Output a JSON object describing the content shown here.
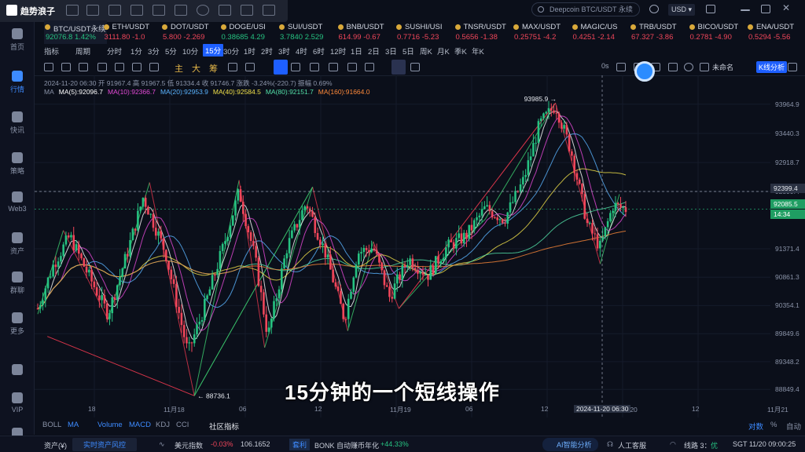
{
  "app": {
    "brand": "趋势浪子",
    "search_placeholder": "Deepcoin BTC/USDT 永续",
    "currency": "USD"
  },
  "sidebar": {
    "items": [
      {
        "label": "首页",
        "icon": "home-icon"
      },
      {
        "label": "行情",
        "icon": "chart-bars-icon"
      },
      {
        "label": "快讯",
        "icon": "news-icon"
      },
      {
        "label": "策略",
        "icon": "robot-icon"
      },
      {
        "label": "Web3",
        "icon": "web3-icon"
      },
      {
        "label": "资产",
        "icon": "wallet-icon"
      },
      {
        "label": "群聊",
        "icon": "chat-icon"
      },
      {
        "label": "更多",
        "icon": "grid-icon"
      },
      {
        "label": "",
        "icon": "phone-icon"
      },
      {
        "label": "VIP",
        "icon": "diamond-icon"
      },
      {
        "label": "",
        "icon": "settings-icon"
      }
    ]
  },
  "ticker": [
    {
      "name": "BTC/USDT永续",
      "price": "92076.8",
      "change": "1.42%",
      "up": true
    },
    {
      "name": "ETH/USDT",
      "price": "3111.80",
      "change": "-1.0",
      "up": false
    },
    {
      "name": "DOT/USDT",
      "price": "5.800",
      "change": "-2.269",
      "up": false
    },
    {
      "name": "DOGE/USI",
      "price": "0.38685",
      "change": "4.29",
      "up": true
    },
    {
      "name": "SUI/USDT",
      "price": "3.7840",
      "change": "2.529",
      "up": true
    },
    {
      "name": "BNB/USDT",
      "price": "614.99",
      "change": "-0.67",
      "up": false
    },
    {
      "name": "SUSHI/USI",
      "price": "0.7716",
      "change": "-5.23",
      "up": false
    },
    {
      "name": "TNSR/USDT",
      "price": "0.5656",
      "change": "-1.38",
      "up": false
    },
    {
      "name": "MAX/USDT",
      "price": "0.25751",
      "change": "-4.2",
      "up": false
    },
    {
      "name": "MAGIC/US",
      "price": "0.4251",
      "change": "-2.14",
      "up": false
    },
    {
      "name": "TRB/USDT",
      "price": "67.327",
      "change": "-3.86",
      "up": false
    },
    {
      "name": "BICO/USDT",
      "price": "0.2781",
      "change": "-4.90",
      "up": false
    },
    {
      "name": "ENA/USDT",
      "price": "0.5294",
      "change": "-5.56",
      "up": false
    }
  ],
  "periods": [
    "指标",
    "周期",
    "分时",
    "1分",
    "3分",
    "5分",
    "10分",
    "15分",
    "30分",
    "1时",
    "2时",
    "3时",
    "4时",
    "6时",
    "12时",
    "1日",
    "2日",
    "3日",
    "5日",
    "周K",
    "月K",
    "季K",
    "年K"
  ],
  "active_period": "15分",
  "toolrow": {
    "labels": [
      "主",
      "大",
      "筹"
    ],
    "countdown": "0s",
    "account": "未命名",
    "kline_btn": "K线分析"
  },
  "info_line": "2024-11-20 06:30  开 91967.4  高 91967.5  低 91334.4  收 91746.7  涨跌 -3.24%(-220.7)  振幅 0.69%",
  "ma_line": {
    "label": "MA",
    "items": [
      {
        "text": "MA(5):92096.7",
        "color": "#ffffff"
      },
      {
        "text": "MA(10):92366.7",
        "color": "#e64ad8"
      },
      {
        "text": "MA(20):92953.9",
        "color": "#5ab4ff"
      },
      {
        "text": "MA(40):92584.5",
        "color": "#f0e04a"
      },
      {
        "text": "MA(80):92151.7",
        "color": "#53e0a8"
      },
      {
        "text": "MA(160):91664.0",
        "color": "#ff8a3a"
      }
    ]
  },
  "chart_data": {
    "type": "candlestick",
    "y_ticks": [
      "93964.9",
      "93440.3",
      "92918.7",
      "92399.4",
      "91371.4",
      "90861.3",
      "90354.1",
      "89849.6",
      "89348.2",
      "88849.4"
    ],
    "x_ticks": [
      "18",
      "11月18",
      "06",
      "12",
      "11月19",
      "06",
      "12",
      "11月20",
      "12",
      "11月21"
    ],
    "cursor_time": "2024-11-20 06:30",
    "crosshair_price": "92399.4",
    "last_price": "92085.5",
    "countdown": "14:34",
    "high_label": "93985.9",
    "low_label": "88736.1",
    "ylim": [
      88600,
      94200
    ],
    "zigzag": [
      [
        0.0,
        90200
      ],
      [
        0.08,
        91700
      ],
      [
        0.22,
        90100
      ],
      [
        0.35,
        92560
      ],
      [
        0.49,
        88736
      ],
      [
        0.63,
        92600
      ],
      [
        0.71,
        89600
      ],
      [
        0.86,
        92480
      ],
      [
        0.97,
        89900
      ],
      [
        1.05,
        91500
      ],
      [
        1.13,
        90300
      ],
      [
        1.27,
        91200
      ],
      [
        1.4,
        91900
      ],
      [
        1.62,
        93985
      ],
      [
        1.76,
        91100
      ],
      [
        1.82,
        92350
      ]
    ],
    "closing_price_path": [
      [
        0.0,
        90300
      ],
      [
        0.05,
        91100
      ],
      [
        0.1,
        91600
      ],
      [
        0.15,
        91000
      ],
      [
        0.22,
        90200
      ],
      [
        0.28,
        91300
      ],
      [
        0.33,
        92300
      ],
      [
        0.4,
        91300
      ],
      [
        0.47,
        89500
      ],
      [
        0.52,
        90300
      ],
      [
        0.58,
        91400
      ],
      [
        0.63,
        92400
      ],
      [
        0.68,
        91200
      ],
      [
        0.72,
        89800
      ],
      [
        0.78,
        91400
      ],
      [
        0.84,
        92200
      ],
      [
        0.9,
        91300
      ],
      [
        0.96,
        90100
      ],
      [
        1.0,
        91300
      ],
      [
        1.05,
        91400
      ],
      [
        1.1,
        90500
      ],
      [
        1.16,
        91200
      ],
      [
        1.22,
        90900
      ],
      [
        1.28,
        91400
      ],
      [
        1.34,
        91600
      ],
      [
        1.4,
        92100
      ],
      [
        1.46,
        91900
      ],
      [
        1.52,
        92600
      ],
      [
        1.57,
        93600
      ],
      [
        1.62,
        93950
      ],
      [
        1.67,
        93100
      ],
      [
        1.72,
        91800
      ],
      [
        1.76,
        91400
      ],
      [
        1.8,
        92150
      ],
      [
        1.84,
        92085
      ]
    ]
  },
  "subtitle": "15分钟的一个短线操作",
  "indicators": {
    "items": [
      "BOLL",
      "MA",
      "Volume",
      "MACD",
      "KDJ",
      "CCI",
      "社区指标"
    ],
    "right": [
      "对数",
      "%",
      "自动"
    ]
  },
  "status": {
    "asset": "资产(¥)",
    "risk_btn": "实时资产风控",
    "dxy_label": "美元指数",
    "dxy_change": "-0.03%",
    "dxy_value": "106.1652",
    "arb_tag": "套利",
    "arb_text": "BONK 自动赚币年化",
    "arb_value": "+44.33%",
    "ai_btn": "AI智能分析",
    "service": "人工客服",
    "line": "线路 3：",
    "line_status": "优",
    "clock": "SGT  11/20 09:00:25"
  },
  "colors": {
    "up": "#26c281",
    "down": "#f0465a",
    "accent": "#1e5fff"
  }
}
